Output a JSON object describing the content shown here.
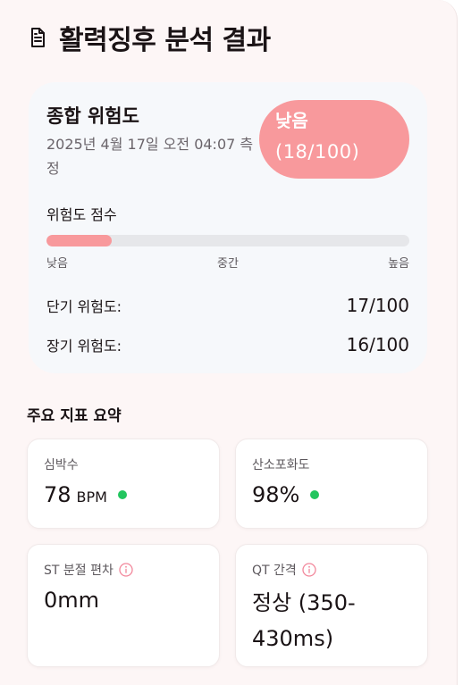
{
  "header": {
    "title": "활력징후 분석 결과",
    "icon": "document-icon"
  },
  "risk": {
    "title": "종합 위험도",
    "measured_at": "2025년 4월 17일 오전 04:07 측정",
    "badge": {
      "level": "낮음",
      "score": "(18/100)",
      "color": "#f8999c"
    },
    "score_label": "위험도 점수",
    "score_fraction": 0.18,
    "scale": {
      "low": "낮음",
      "mid": "중간",
      "high": "높음"
    },
    "short_term": {
      "label": "단기 위험도:",
      "value": "17/100"
    },
    "long_term": {
      "label": "장기 위험도:",
      "value": "16/100"
    }
  },
  "summary": {
    "title": "주요 지표 요약",
    "heart_rate": {
      "label": "심박수",
      "value": "78",
      "unit": "BPM",
      "status_color": "#22c55e"
    },
    "spo2": {
      "label": "산소포화도",
      "value": "98%",
      "status_color": "#22c55e"
    },
    "st": {
      "label": "ST 분절 편차",
      "value": "0mm",
      "icon": "info-icon"
    },
    "qt": {
      "label": "QT 간격",
      "value": "정상 (350-430ms)",
      "icon": "info-icon"
    }
  }
}
